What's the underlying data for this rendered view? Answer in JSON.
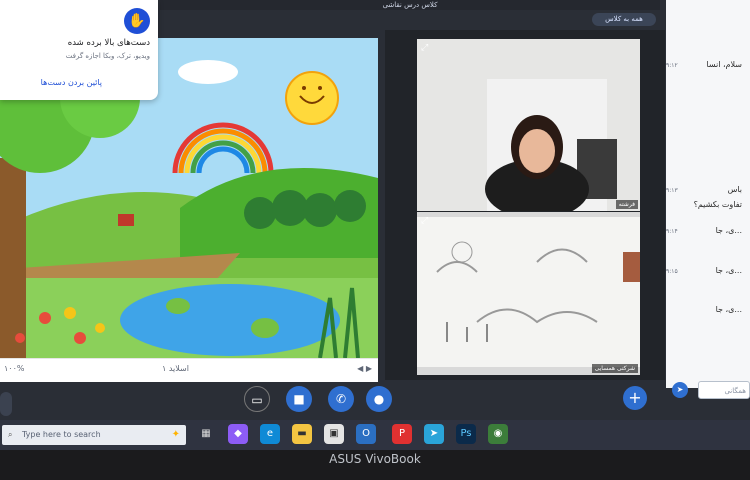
{
  "topbar": {
    "title": "کلاس درس نقاشی"
  },
  "top_pill": {
    "label": "همه به کلاس"
  },
  "hand_panel": {
    "title": "دست‌های بالا برده شده",
    "subtitle": "ویدیو، ترک، وبکا اجازه گرفت",
    "link": "پائین بردن دست‌ها"
  },
  "slidebar": {
    "left": "۱۰۰%",
    "page": "اسلاید ۱",
    "zoom": "◀ ▶"
  },
  "video": {
    "tile1_label": "فرشته",
    "tile2_label": "شرکتی همسایی"
  },
  "chat": {
    "messages": [
      {
        "text": "سلام، انسا",
        "time": "۹:۱۲"
      },
      {
        "text": "باس",
        "time": "۹:۱۳"
      },
      {
        "text": "تفاوت بکشیم؟",
        "time": ""
      },
      {
        "text": "ی، جا...",
        "time": "۹:۱۴"
      },
      {
        "text": "ی، جا...",
        "time": "۹:۱۵"
      },
      {
        "text": "ی، جا...",
        "time": ""
      }
    ],
    "input_placeholder": "همگانی"
  },
  "controls": {
    "share_icon": "screen-share-off-icon",
    "camera_icon": "camera-icon",
    "phone_icon": "phone-icon",
    "mic_icon": "microphone-icon"
  },
  "taskbar": {
    "search_placeholder": "Type here to search",
    "apps": [
      "task-view-icon",
      "copilot-icon",
      "edge-icon",
      "file-explorer-icon",
      "store-icon",
      "outlook-icon",
      "pinterest-icon",
      "telegram-icon",
      "photoshop-icon",
      "chrome-icon"
    ]
  },
  "brand": "ASUS VivoBook",
  "colors": {
    "accent": "#2f6fd0",
    "danger": "#e03131"
  }
}
